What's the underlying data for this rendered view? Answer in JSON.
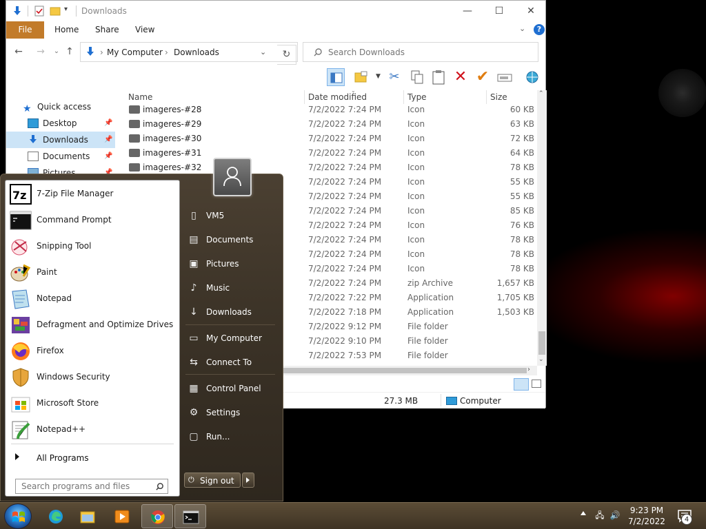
{
  "colors": {
    "file_tab": "#c27b2a",
    "accent_blue": "#1f6fd1",
    "start_menu": "#3d3428",
    "taskbar": "#4b3e2c",
    "delete_red": "#d0111b",
    "check_orange": "#e07d10"
  },
  "explorer": {
    "title": "Downloads",
    "ribbon_tabs": [
      "File",
      "Home",
      "Share",
      "View"
    ],
    "address": {
      "root": "My Computer",
      "current": "Downloads"
    },
    "search_placeholder": "Search Downloads",
    "nav": [
      {
        "label": "Quick access",
        "icon": "star-icon"
      },
      {
        "label": "Desktop",
        "icon": "desktop-icon"
      },
      {
        "label": "Downloads",
        "icon": "download-icon"
      },
      {
        "label": "Documents",
        "icon": "documents-icon"
      },
      {
        "label": "Pictures",
        "icon": "pictures-icon"
      }
    ],
    "columns": {
      "name": "Name",
      "date": "Date modified",
      "type": "Type",
      "size": "Size"
    },
    "files": [
      {
        "name": "imageres-#28",
        "date": "7/2/2022 7:24 PM",
        "type": "Icon",
        "size": "60 KB"
      },
      {
        "name": "imageres-#29",
        "date": "7/2/2022 7:24 PM",
        "type": "Icon",
        "size": "63 KB"
      },
      {
        "name": "imageres-#30",
        "date": "7/2/2022 7:24 PM",
        "type": "Icon",
        "size": "72 KB"
      },
      {
        "name": "imageres-#31",
        "date": "7/2/2022 7:24 PM",
        "type": "Icon",
        "size": "64 KB"
      },
      {
        "name": "imageres-#32",
        "date": "7/2/2022 7:24 PM",
        "type": "Icon",
        "size": "78 KB"
      },
      {
        "name": "",
        "date": "7/2/2022 7:24 PM",
        "type": "Icon",
        "size": "55 KB"
      },
      {
        "name": "",
        "date": "7/2/2022 7:24 PM",
        "type": "Icon",
        "size": "55 KB"
      },
      {
        "name": "",
        "date": "7/2/2022 7:24 PM",
        "type": "Icon",
        "size": "85 KB"
      },
      {
        "name": "",
        "date": "7/2/2022 7:24 PM",
        "type": "Icon",
        "size": "76 KB"
      },
      {
        "name": "",
        "date": "7/2/2022 7:24 PM",
        "type": "Icon",
        "size": "78 KB"
      },
      {
        "name": "",
        "date": "7/2/2022 7:24 PM",
        "type": "Icon",
        "size": "78 KB"
      },
      {
        "name": "",
        "date": "7/2/2022 7:24 PM",
        "type": "Icon",
        "size": "78 KB"
      },
      {
        "name": "",
        "date": "7/2/2022 7:24 PM",
        "type": "zip Archive",
        "size": "1,657 KB"
      },
      {
        "name": "",
        "date": "7/2/2022 7:22 PM",
        "type": "Application",
        "size": "1,705 KB"
      },
      {
        "name": "",
        "date": "7/2/2022 7:18 PM",
        "type": "Application",
        "size": "1,503 KB"
      },
      {
        "name": "",
        "date": "7/2/2022 9:12 PM",
        "type": "File folder",
        "size": ""
      },
      {
        "name": "",
        "date": "7/2/2022 9:10 PM",
        "type": "File folder",
        "size": ""
      },
      {
        "name": "",
        "date": "7/2/2022 7:53 PM",
        "type": "File folder",
        "size": ""
      }
    ],
    "status": {
      "size": "27.3 MB",
      "location": "Computer"
    }
  },
  "startmenu": {
    "apps": [
      {
        "label": "7-Zip File Manager",
        "icon": "7zip-icon"
      },
      {
        "label": "Command Prompt",
        "icon": "cmd-icon"
      },
      {
        "label": "Snipping Tool",
        "icon": "snipping-tool-icon"
      },
      {
        "label": "Paint",
        "icon": "paint-icon"
      },
      {
        "label": "Notepad",
        "icon": "notepad-icon"
      },
      {
        "label": "Defragment and Optimize Drives",
        "icon": "defrag-icon"
      },
      {
        "label": "Firefox",
        "icon": "firefox-icon"
      },
      {
        "label": "Windows Security",
        "icon": "shield-icon"
      },
      {
        "label": "Microsoft Store",
        "icon": "store-icon"
      },
      {
        "label": "Notepad++",
        "icon": "notepadpp-icon"
      }
    ],
    "all_programs": "All Programs",
    "search_placeholder": "Search programs and files",
    "right": [
      {
        "label": "VM5",
        "icon": "user-folder-icon"
      },
      {
        "label": "Documents",
        "icon": "documents-icon"
      },
      {
        "label": "Pictures",
        "icon": "pictures-icon"
      },
      {
        "label": "Music",
        "icon": "music-icon"
      },
      {
        "label": "Downloads",
        "icon": "download-icon"
      },
      {
        "label": "My Computer",
        "icon": "computer-icon"
      },
      {
        "label": "Connect To",
        "icon": "network-icon"
      },
      {
        "label": "Control Panel",
        "icon": "control-panel-icon"
      },
      {
        "label": "Settings",
        "icon": "gear-icon"
      },
      {
        "label": "Run...",
        "icon": "run-icon"
      }
    ],
    "sign_out": "Sign out"
  },
  "taskbar": {
    "apps": [
      {
        "name": "edge",
        "icon": "edge-icon"
      },
      {
        "name": "file-explorer",
        "icon": "folder-icon"
      },
      {
        "name": "media-player",
        "icon": "media-player-icon"
      },
      {
        "name": "chrome",
        "icon": "chrome-icon"
      },
      {
        "name": "command-prompt",
        "icon": "cmd-icon"
      }
    ],
    "time": "9:23 PM",
    "date": "7/2/2022",
    "notifications": "4"
  }
}
